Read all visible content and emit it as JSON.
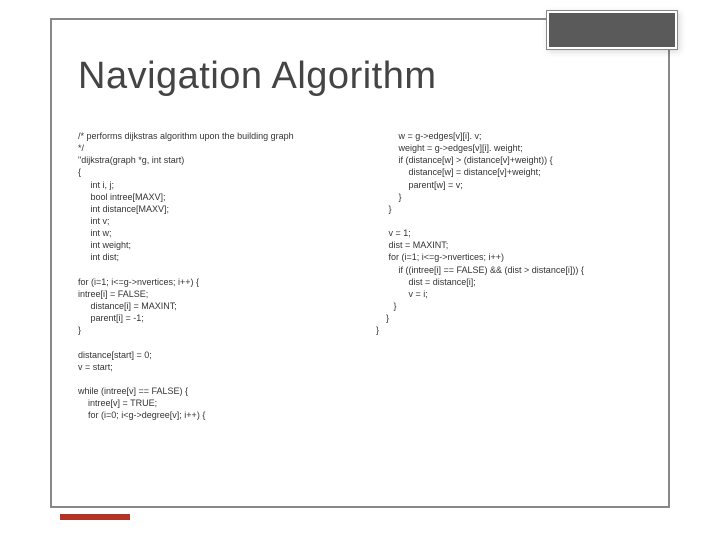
{
  "title": "Navigation Algorithm",
  "code_left": "/* performs dijkstras algorithm upon the building graph\n*/\n\"dijkstra(graph *g, int start)\n{\n     int i, j;\n     bool intree[MAXV];\n     int distance[MAXV];\n     int v;\n     int w;\n     int weight;\n     int dist;\n\nfor (i=1; i<=g->nvertices; i++) {\nintree[i] = FALSE;\n     distance[i] = MAXINT;\n     parent[i] = -1;\n}\n\ndistance[start] = 0;\nv = start;\n\nwhile (intree[v] == FALSE) {\n    intree[v] = TRUE;\n    for (i=0; i<g->degree[v]; i++) {",
  "code_right": "         w = g->edges[v][i]. v;\n         weight = g->edges[v][i]. weight;\n         if (distance[w] > (distance[v]+weight)) {\n             distance[w] = distance[v]+weight;\n             parent[w] = v;\n         }\n     }\n\n     v = 1;\n     dist = MAXINT;\n     for (i=1; i<=g->nvertices; i++)\n         if ((intree[i] == FALSE) && (dist > distance[i])) {\n             dist = distance[i];\n             v = i;\n       }\n    }\n}"
}
